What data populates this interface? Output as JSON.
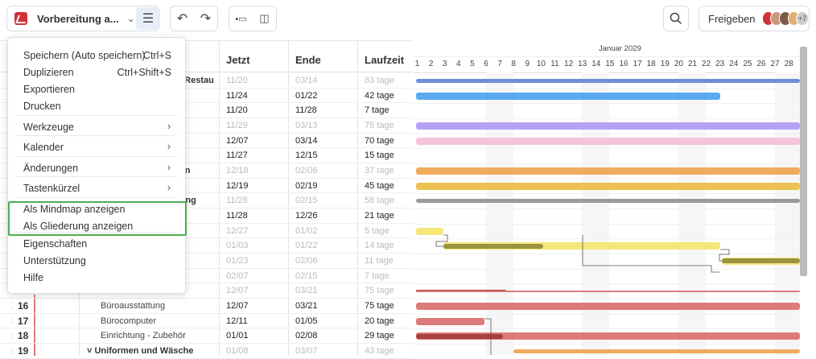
{
  "toolbar": {
    "project_name": "Vorbereitung a...",
    "share_label": "Freigeben",
    "extra_users": "+7"
  },
  "menu": {
    "items": [
      {
        "label": "Speichern (Auto speichern)",
        "shortcut": "Ctrl+S"
      },
      {
        "label": "Duplizieren",
        "shortcut": "Ctrl+Shift+S"
      },
      {
        "label": "Exportieren"
      },
      {
        "label": "Drucken"
      },
      {
        "label": "Werkzeuge",
        "submenu": true
      },
      {
        "label": "Kalender",
        "submenu": true
      },
      {
        "label": "Änderungen",
        "submenu": true
      },
      {
        "label": "Tastenkürzel",
        "submenu": true
      },
      {
        "label": "Als Mindmap anzeigen"
      },
      {
        "label": "Als Gliederung anzeigen"
      },
      {
        "label": "Eigenschaften"
      },
      {
        "label": "Unterstützung"
      },
      {
        "label": "Hilfe"
      }
    ]
  },
  "table": {
    "headers": {
      "start": "Jetzt",
      "end": "Ende",
      "duration": "Laufzeit"
    },
    "rows": [
      {
        "name": "s Restau",
        "start": "11/20",
        "end": "03/14",
        "dur": "83 tage",
        "muted": true
      },
      {
        "name": "",
        "start": "11/24",
        "end": "01/22",
        "dur": "42 tage"
      },
      {
        "name": "",
        "start": "11/20",
        "end": "11/28",
        "dur": "7 tage"
      },
      {
        "name": "",
        "start": "11/29",
        "end": "03/13",
        "dur": "75 tage",
        "muted": true
      },
      {
        "name": "",
        "start": "12/07",
        "end": "03/14",
        "dur": "70 tage"
      },
      {
        "name": "",
        "start": "11/27",
        "end": "12/15",
        "dur": "15 tage"
      },
      {
        "name": "ion",
        "start": "12/18",
        "end": "02/06",
        "dur": "37 tage",
        "muted": true
      },
      {
        "name": "",
        "start": "12/19",
        "end": "02/19",
        "dur": "45 tage"
      },
      {
        "name": "tung",
        "start": "11/28",
        "end": "02/15",
        "dur": "58 tage",
        "muted": true
      },
      {
        "name": "",
        "start": "11/28",
        "end": "12/26",
        "dur": "21 tage"
      },
      {
        "name": "",
        "start": "12/27",
        "end": "01/02",
        "dur": "5 tage",
        "muted": true
      },
      {
        "name": "",
        "start": "01/03",
        "end": "01/22",
        "dur": "14 tage",
        "muted": true
      },
      {
        "name": "",
        "start": "01/23",
        "end": "02/06",
        "dur": "11 tage",
        "muted": true
      },
      {
        "name": "",
        "start": "02/07",
        "end": "02/15",
        "dur": "7 tage",
        "muted": true
      },
      {
        "name": "",
        "start": "12/07",
        "end": "03/21",
        "dur": "75 tage",
        "muted": true
      },
      {
        "num": "16",
        "name": "Büroausstattung",
        "start": "12/07",
        "end": "03/21",
        "dur": "75 tage"
      },
      {
        "num": "17",
        "name": "Bürocomputer",
        "start": "12/11",
        "end": "01/05",
        "dur": "20 tage"
      },
      {
        "num": "18",
        "name": "Einrichtung - Zubehör",
        "start": "01/01",
        "end": "02/08",
        "dur": "29 tage"
      },
      {
        "num": "19",
        "name": "Uniformen und Wäsche",
        "start": "01/08",
        "end": "03/07",
        "dur": "43 tage",
        "muted": true,
        "group": true
      }
    ]
  },
  "gantt": {
    "month": "Januar 2029",
    "days": [
      "1",
      "2",
      "3",
      "4",
      "5",
      "6",
      "7",
      "8",
      "9",
      "10",
      "11",
      "12",
      "13",
      "14",
      "15",
      "16",
      "17",
      "18",
      "19",
      "20",
      "21",
      "22",
      "23",
      "24",
      "25",
      "26",
      "27",
      "28"
    ]
  },
  "colors": {
    "blue": "#6d8fd8",
    "lightblue": "#5aaaf0",
    "purple": "#b3a2f3",
    "pink": "#f5c3dc",
    "orange": "#f0ab5e",
    "yellow": "#ebc251",
    "gray": "#9a9a9a",
    "lightyellow": "#f5e678",
    "olive": "#9b9340",
    "red": "#dd7a7a",
    "darkred": "#a94040",
    "highlight": "#4caf50"
  }
}
